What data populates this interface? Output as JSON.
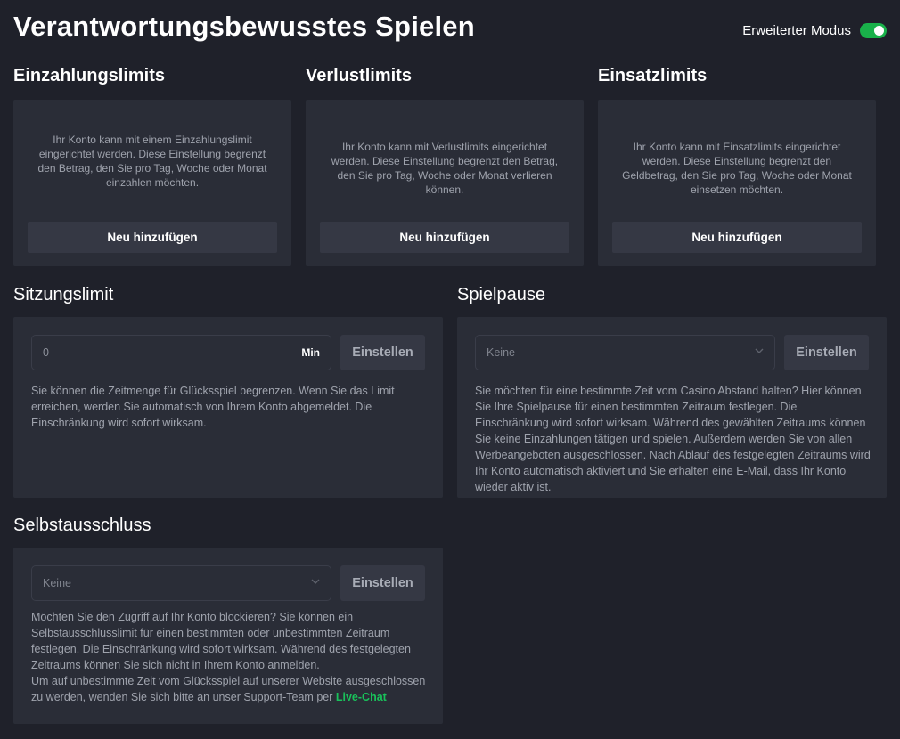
{
  "header": {
    "title": "Verantwortungsbewusstes Spielen",
    "mode_label": "Erweiterter Modus",
    "mode_enabled": true
  },
  "limits": [
    {
      "title": "Einzahlungslimits",
      "description": "Ihr Konto kann mit einem Einzahlungslimit eingerichtet werden. Diese Einstellung begrenzt den Betrag, den Sie pro Tag, Woche oder Monat einzahlen möchten.",
      "button": "Neu hinzufügen"
    },
    {
      "title": "Verlustlimits",
      "description": "Ihr Konto kann mit Verlustlimits eingerichtet werden. Diese Einstellung begrenzt den Betrag, den Sie pro Tag, Woche oder Monat verlieren können.",
      "button": "Neu hinzufügen"
    },
    {
      "title": "Einsatzlimits",
      "description": "Ihr Konto kann mit Einsatzlimits eingerichtet werden. Diese Einstellung begrenzt den Geldbetrag, den Sie pro Tag, Woche oder Monat einsetzen möchten.",
      "button": "Neu hinzufügen"
    }
  ],
  "session": {
    "title": "Sitzungslimit",
    "input_value": "0",
    "unit": "Min",
    "button": "Einstellen",
    "description": "Sie können die Zeitmenge für Glücksspiel begrenzen. Wenn Sie das Limit erreichen, werden Sie automatisch von Ihrem Konto abgemeldet. Die Einschränkung wird sofort wirksam."
  },
  "pause": {
    "title": "Spielpause",
    "selected": "Keine",
    "button": "Einstellen",
    "description": "Sie möchten für eine bestimmte Zeit vom Casino Abstand halten? Hier können Sie Ihre Spielpause für einen bestimmten Zeitraum festlegen. Die Einschränkung wird sofort wirksam. Während des gewählten Zeitraums können Sie keine Einzahlungen tätigen und spielen. Außerdem werden Sie von allen Werbeangeboten ausgeschlossen. Nach Ablauf des festgelegten Zeitraums wird Ihr Konto automatisch aktiviert und Sie erhalten eine E-Mail, dass Ihr Konto wieder aktiv ist."
  },
  "exclusion": {
    "title": "Selbstausschluss",
    "selected": "Keine",
    "button": "Einstellen",
    "description": "Möchten Sie den Zugriff auf Ihr Konto blockieren? Sie können ein Selbstausschlusslimit für einen bestimmten oder unbestimmten Zeitraum festlegen. Die Einschränkung wird sofort wirksam. Während des festgelegten Zeitraums können Sie sich nicht in Ihrem Konto anmelden.",
    "description2": "Um auf unbestimmte Zeit vom Glücksspiel auf unserer Website ausgeschlossen zu werden, wenden Sie sich bitte an unser Support-Team per",
    "link": "Live-Chat"
  },
  "colors": {
    "background": "#1f212a",
    "card": "#2a2d37",
    "button": "#353844",
    "accent_green": "#19b14a",
    "muted_text": "#9fa3ad"
  }
}
